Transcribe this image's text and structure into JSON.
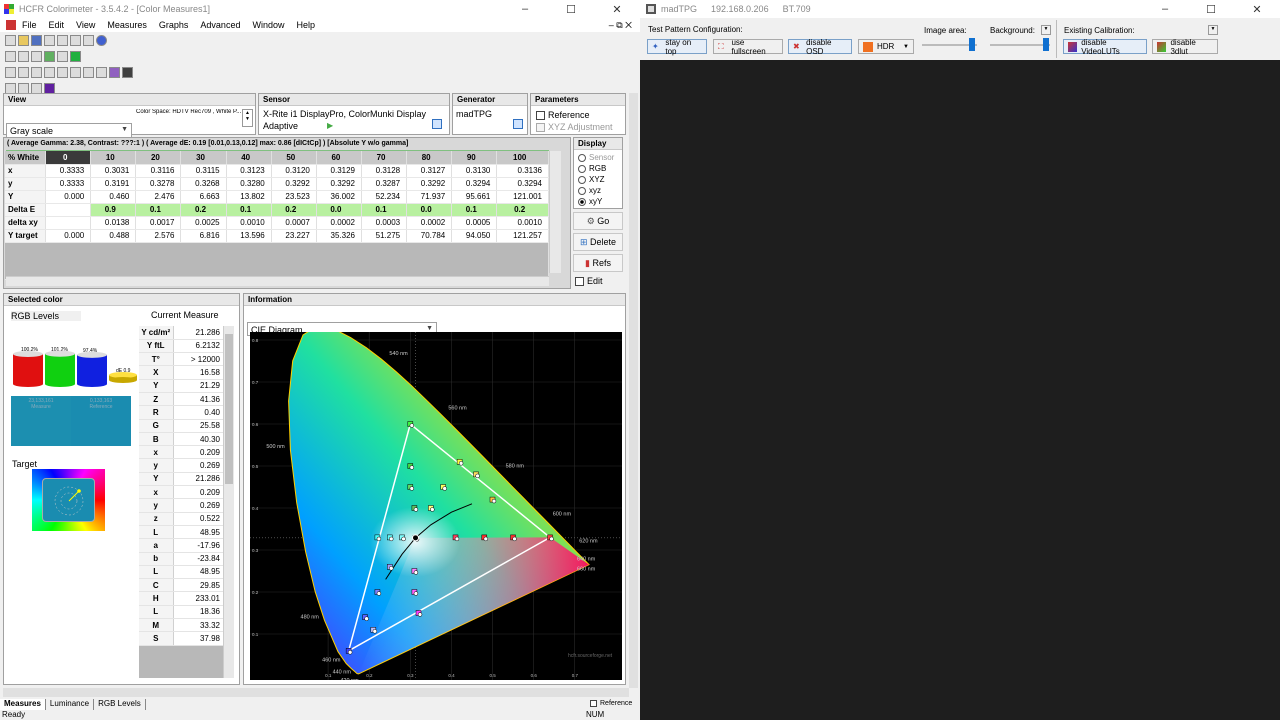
{
  "hcfr": {
    "title": "HCFR Colorimeter - 3.5.4.2 - [Color Measures1]",
    "menu": [
      "File",
      "Edit",
      "View",
      "Measures",
      "Graphs",
      "Advanced",
      "Window",
      "Help"
    ],
    "view": {
      "header": "View",
      "selected": "Gray scale",
      "colorspace": "Color Space: HDTV Rec709 , White P..."
    },
    "sensor": {
      "header": "Sensor",
      "name": "X-Rite i1 DisplayPro, ColorMunki Display",
      "mode": "Adaptive"
    },
    "generator": {
      "header": "Generator",
      "name": "madTPG"
    },
    "parameters": {
      "header": "Parameters",
      "reference": "Reference",
      "xyz_adjust": "XYZ Adjustment"
    },
    "summary": "( Average Gamma: 2.38, Contrast: ???:1 ) ( Average dE: 0.19 [0.01,0.13,0.12] max: 0.86 [dICtCp] ) [Absolute Y w/o gamma]",
    "table": {
      "columns": [
        "% White",
        "0",
        "10",
        "20",
        "30",
        "40",
        "50",
        "60",
        "70",
        "80",
        "90",
        "100"
      ],
      "rows": [
        [
          "x",
          "0.3333",
          "0.3031",
          "0.3116",
          "0.3115",
          "0.3123",
          "0.3120",
          "0.3129",
          "0.3128",
          "0.3127",
          "0.3130",
          "0.3136"
        ],
        [
          "y",
          "0.3333",
          "0.3191",
          "0.3278",
          "0.3268",
          "0.3280",
          "0.3292",
          "0.3292",
          "0.3287",
          "0.3292",
          "0.3294",
          "0.3294"
        ],
        [
          "Y",
          "0.000",
          "0.460",
          "2.476",
          "6.663",
          "13.802",
          "23.523",
          "36.002",
          "52.234",
          "71.937",
          "95.661",
          "121.001"
        ],
        [
          "Delta E",
          "",
          "0.9",
          "0.1",
          "0.2",
          "0.1",
          "0.2",
          "0.0",
          "0.1",
          "0.0",
          "0.1",
          "0.2"
        ],
        [
          "delta xy",
          "",
          "0.0138",
          "0.0017",
          "0.0025",
          "0.0010",
          "0.0007",
          "0.0002",
          "0.0003",
          "0.0002",
          "0.0005",
          "0.0010"
        ],
        [
          "Y target",
          "0.000",
          "0.488",
          "2.576",
          "6.816",
          "13.596",
          "23.227",
          "35.326",
          "51.275",
          "70.784",
          "94.050",
          "121.257"
        ]
      ]
    },
    "display": {
      "header": "Display",
      "options": [
        "Sensor",
        "RGB",
        "XYZ",
        "xyz",
        "xyY"
      ],
      "selected": "xyY"
    },
    "buttons": {
      "go": "Go",
      "delete": "Delete",
      "refs": "Refs",
      "edit": "Edit"
    },
    "selected_color": {
      "header": "Selected color",
      "rgb_levels": "RGB Levels",
      "current_measure": "Current Measure",
      "bars": {
        "r": "100.2%",
        "g": "101.2%",
        "b": "97.4%",
        "de": "dE 0.9"
      },
      "swatch_measure": "23,133,161",
      "swatch_measure_label": "Measure",
      "swatch_ref": "0,133,163",
      "swatch_ref_label": "Reference",
      "target": "Target",
      "measure_color": "#1c8fb0",
      "reference_color": "#1a8cb0",
      "values": [
        [
          "Y cd/m²",
          "21.286"
        ],
        [
          "Y ftL",
          "6.2132"
        ],
        [
          "T°",
          "> 12000"
        ],
        [
          "X",
          "16.58"
        ],
        [
          "Y",
          "21.29"
        ],
        [
          "Z",
          "41.36"
        ],
        [
          "R",
          "0.40"
        ],
        [
          "G",
          "25.58"
        ],
        [
          "B",
          "40.30"
        ],
        [
          "x",
          "0.209"
        ],
        [
          "y",
          "0.269"
        ],
        [
          "Y",
          "21.286"
        ],
        [
          "x",
          "0.209"
        ],
        [
          "y",
          "0.269"
        ],
        [
          "z",
          "0.522"
        ],
        [
          "L",
          "48.95"
        ],
        [
          "a",
          "-17.96"
        ],
        [
          "b",
          "-23.84"
        ],
        [
          "L",
          "48.95"
        ],
        [
          "C",
          "29.85"
        ],
        [
          "H",
          "233.01"
        ],
        [
          "L",
          "18.36"
        ],
        [
          "M",
          "33.32"
        ],
        [
          "S",
          "37.98"
        ]
      ]
    },
    "information": {
      "header": "Information",
      "diagram": "CIE Diagram",
      "watermark": "hcfr.sourceforge.net",
      "nm_labels": [
        "520 nm",
        "540 nm",
        "560 nm",
        "580 nm",
        "600 nm",
        "620 nm",
        "640 nm",
        "660 nm",
        "500 nm",
        "480 nm",
        "460 nm",
        "440 nm",
        "420 nm"
      ],
      "axis_x": [
        "0.1",
        "0.2",
        "0.3",
        "0.4",
        "0.5",
        "0.6",
        "0.7"
      ],
      "axis_y": [
        "0.8",
        "0.7",
        "0.6",
        "0.5",
        "0.4",
        "0.3",
        "0.2",
        "0.1"
      ]
    },
    "tabs": [
      "Measures",
      "Luminance",
      "RGB Levels"
    ],
    "status": {
      "ready": "Ready",
      "num": "NUM",
      "reference": "Reference"
    }
  },
  "madtpg": {
    "title": "madTPG",
    "ip": "192.168.0.206",
    "standard": "BT.709",
    "config_label": "Test Pattern Configuration:",
    "image_area": "Image area:",
    "background": "Background:",
    "existing_cal": "Existing Calibration:",
    "buttons": [
      "stay on top",
      "use fullscreen",
      "disable OSD",
      "HDR",
      "disable VideoLUTs",
      "disable 3dlut"
    ]
  }
}
